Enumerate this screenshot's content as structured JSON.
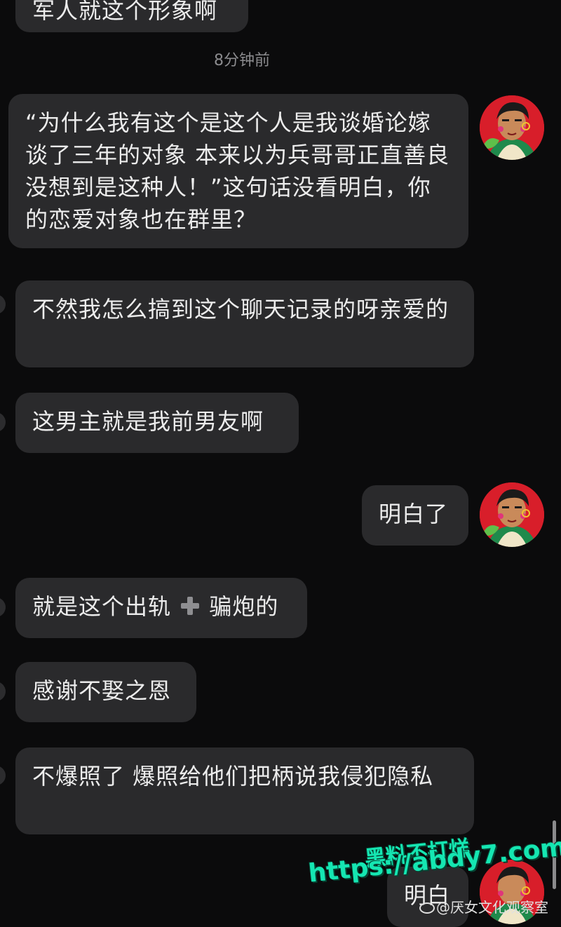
{
  "messages": [
    {
      "side": "left",
      "text": "军人就这个形象啊"
    },
    {
      "side": "right",
      "text": "“为什么我有这个是这个人是我谈婚论嫁 谈了三年的对象 本来以为兵哥哥正直善良 没想到是这种人！”这句话没看明白，你的恋爱对象也在群里？"
    },
    {
      "side": "left",
      "text": "不然我怎么搞到这个聊天记录的呀亲爱的"
    },
    {
      "side": "left",
      "text": "这男主就是我前男友啊"
    },
    {
      "side": "right",
      "text": "明白了"
    },
    {
      "side": "left",
      "text_before": "就是这个出轨",
      "emoji": "heavy-plus-icon",
      "text_after": "骗炮的"
    },
    {
      "side": "left",
      "text": "感谢不娶之恩"
    },
    {
      "side": "left",
      "text": "不爆照了 爆照给他们把柄说我侵犯隐私"
    },
    {
      "side": "right",
      "text": "明白"
    }
  ],
  "timestamp": "8分钟前",
  "watermark": {
    "line1": "黑料不打烊",
    "line2": "https://abdy7.com",
    "weibo_handle": "@厌女文化观察室"
  },
  "colors": {
    "background": "#0b0b0c",
    "bubble": "#2a2a2c",
    "text": "#ececec",
    "timestamp": "#8b8b8e",
    "watermark": "#15e6b2",
    "avatar_red": "#d81e2a"
  },
  "icons": {
    "self_avatar": "avatar-illustration-icon",
    "other_avatar": "avatar-edge-icon"
  }
}
